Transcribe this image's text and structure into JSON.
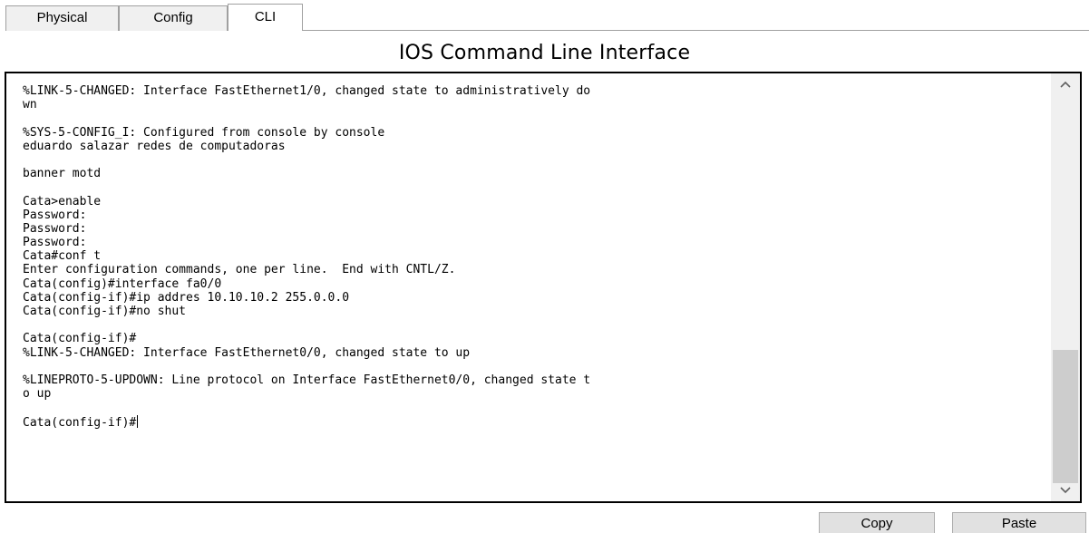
{
  "tabs": [
    {
      "label": "Physical"
    },
    {
      "label": "Config"
    },
    {
      "label": "CLI"
    }
  ],
  "active_tab": "CLI",
  "title": "IOS Command Line Interface",
  "console_lines": [
    "%LINK-5-CHANGED: Interface FastEthernet1/0, changed state to administratively do",
    "wn",
    "",
    "%SYS-5-CONFIG_I: Configured from console by console",
    "eduardo salazar redes de computadoras",
    "",
    "banner motd",
    "",
    "Cata>enable",
    "Password:",
    "Password:",
    "Password:",
    "Cata#conf t",
    "Enter configuration commands, one per line.  End with CNTL/Z.",
    "Cata(config)#interface fa0/0",
    "Cata(config-if)#ip addres 10.10.10.2 255.0.0.0",
    "Cata(config-if)#no shut",
    "",
    "Cata(config-if)#",
    "%LINK-5-CHANGED: Interface FastEthernet0/0, changed state to up",
    "",
    "%LINEPROTO-5-UPDOWN: Line protocol on Interface FastEthernet0/0, changed state t",
    "o up",
    "",
    "Cata(config-if)#"
  ],
  "buttons": {
    "copy": "Copy",
    "paste": "Paste"
  },
  "icons": {
    "scroll_up": "chevron-up-icon",
    "scroll_down": "chevron-down-icon"
  }
}
